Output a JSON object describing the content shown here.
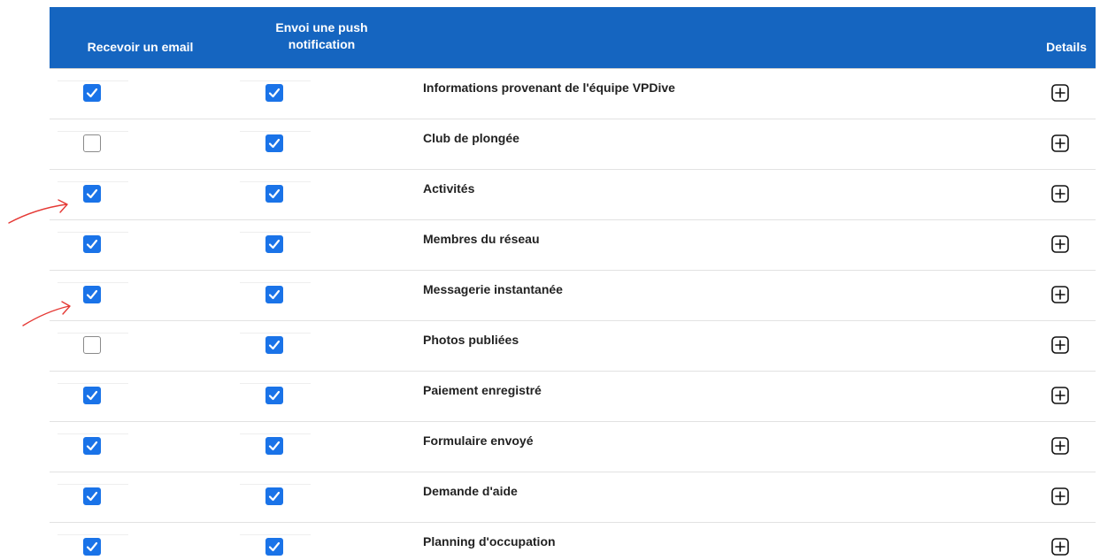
{
  "header": {
    "email_col": "Recevoir un email",
    "push_col_line1": "Envoi une push",
    "push_col_line2": "notification",
    "details_col": "Details"
  },
  "rows": [
    {
      "label": "Informations provenant de l'équipe VPDive",
      "email": true,
      "push": true
    },
    {
      "label": "Club de plongée",
      "email": false,
      "push": true
    },
    {
      "label": "Activités",
      "email": true,
      "push": true
    },
    {
      "label": "Membres du réseau",
      "email": true,
      "push": true
    },
    {
      "label": "Messagerie instantanée",
      "email": true,
      "push": true
    },
    {
      "label": "Photos publiées",
      "email": false,
      "push": true
    },
    {
      "label": "Paiement enregistré",
      "email": true,
      "push": true
    },
    {
      "label": "Formulaire envoyé",
      "email": true,
      "push": true
    },
    {
      "label": "Demande d'aide",
      "email": true,
      "push": true
    },
    {
      "label": "Planning d'occupation",
      "email": true,
      "push": true
    }
  ],
  "icons": {
    "checked": "check-icon",
    "details": "plus-square-icon",
    "annotation": "red-arrow-annotation"
  },
  "colors": {
    "header_bg": "#1565c0",
    "checkbox_checked": "#1a73e8",
    "annotation": "#e53935"
  }
}
